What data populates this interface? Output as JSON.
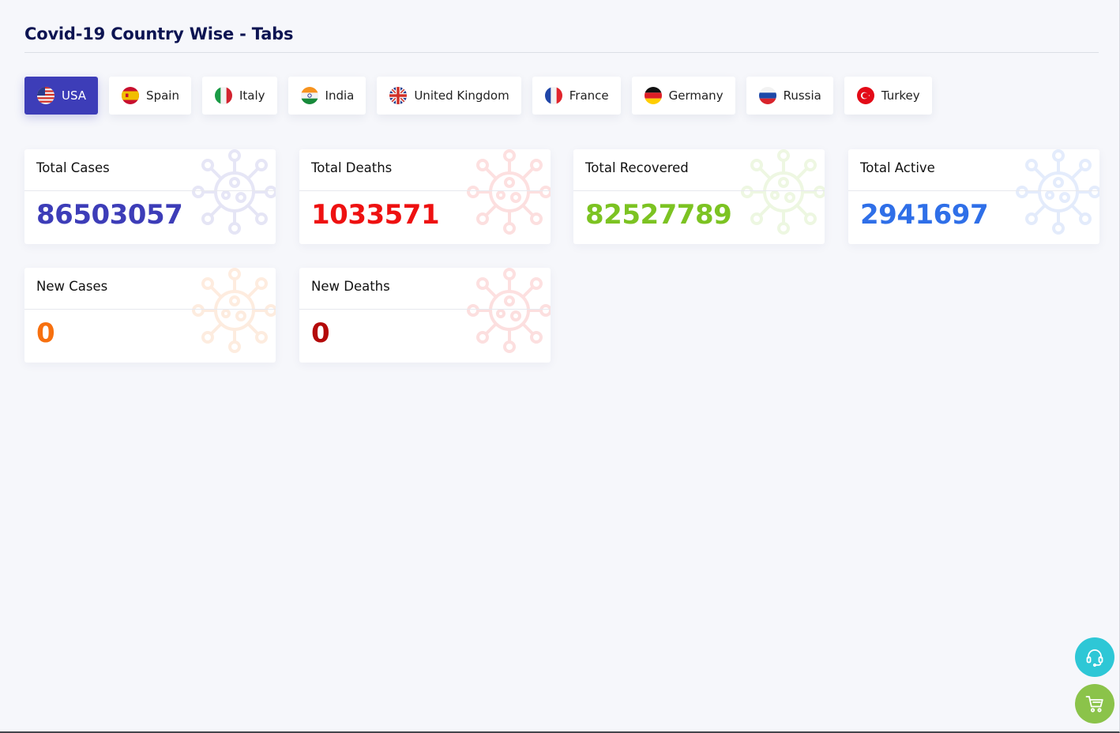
{
  "header": {
    "title": "Covid-19 Country Wise - Tabs"
  },
  "tabs": [
    {
      "label": "USA",
      "flag": "us-flag-icon"
    },
    {
      "label": "Spain",
      "flag": "spain-flag-icon"
    },
    {
      "label": "Italy",
      "flag": "italy-flag-icon"
    },
    {
      "label": "India",
      "flag": "india-flag-icon"
    },
    {
      "label": "United Kingdom",
      "flag": "uk-flag-icon"
    },
    {
      "label": "France",
      "flag": "france-flag-icon"
    },
    {
      "label": "Germany",
      "flag": "germany-flag-icon"
    },
    {
      "label": "Russia",
      "flag": "russia-flag-icon"
    },
    {
      "label": "Turkey",
      "flag": "turkey-flag-icon"
    }
  ],
  "active_tab": "USA",
  "stats": [
    {
      "title": "Total Cases",
      "value": "86503057",
      "color": "#3d3db8",
      "icon": "virus-icon"
    },
    {
      "title": "Total Deaths",
      "value": "1033571",
      "color": "#ee1111",
      "icon": "virus-icon"
    },
    {
      "title": "Total Recovered",
      "value": "82527789",
      "color": "#7cc322",
      "icon": "virus-icon"
    },
    {
      "title": "Total Active",
      "value": "2941697",
      "color": "#2f6fe8",
      "icon": "virus-icon"
    },
    {
      "title": "New Cases",
      "value": "0",
      "color": "#f7700f",
      "icon": "virus-icon"
    },
    {
      "title": "New Deaths",
      "value": "0",
      "color": "#b40a0a",
      "icon": "virus-icon"
    }
  ],
  "floating_buttons": [
    {
      "name": "support",
      "icon": "headset-icon",
      "color": "#2ec7d6"
    },
    {
      "name": "cart",
      "icon": "cart-icon",
      "color": "#8bc34a"
    }
  ]
}
